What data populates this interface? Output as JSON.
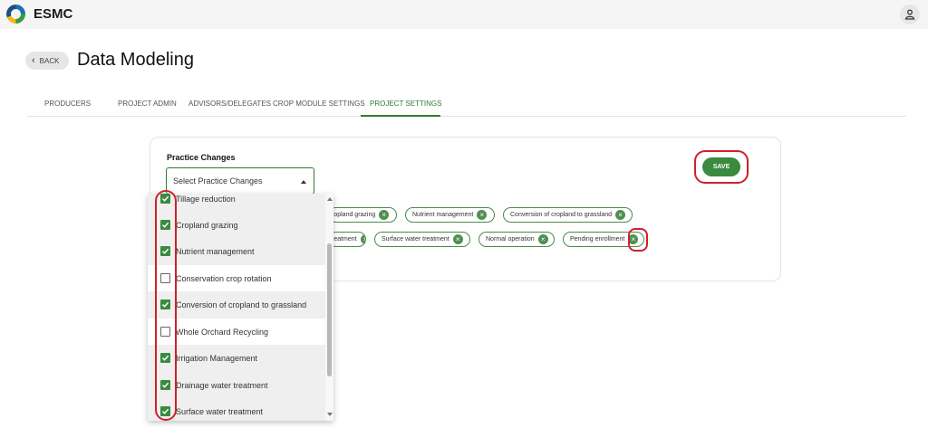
{
  "app": {
    "name": "ESMC"
  },
  "header": {
    "back_label": "BACK",
    "title": "Data Modeling"
  },
  "tabs": [
    {
      "label": "PRODUCERS",
      "active": false
    },
    {
      "label": "PROJECT ADMIN",
      "active": false
    },
    {
      "label": "ADVISORS/DELEGATES",
      "active": false
    },
    {
      "label": "CROP MODULE SETTINGS",
      "active": false
    },
    {
      "label": "PROJECT SETTINGS",
      "active": true
    }
  ],
  "practice_changes": {
    "label": "Practice Changes",
    "placeholder": "Select Practice Changes",
    "save_label": "SAVE",
    "chips_row1": [
      "ropland grazing",
      "Nutrient management",
      "Conversion of cropland to grassland"
    ],
    "chips_row2": [
      "reatment",
      "Surface water treatment",
      "Normal operation",
      "Pending enrollment"
    ]
  },
  "dropdown": {
    "options": [
      {
        "label": "Tillage reduction",
        "checked": true
      },
      {
        "label": "Cropland grazing",
        "checked": true
      },
      {
        "label": "Nutrient management",
        "checked": true
      },
      {
        "label": "Conservation crop rotation",
        "checked": false
      },
      {
        "label": "Conversion of cropland to grassland",
        "checked": true
      },
      {
        "label": "Whole Orchard Recycling",
        "checked": false
      },
      {
        "label": "Irrigation Management",
        "checked": true
      },
      {
        "label": "Drainage water treatment",
        "checked": true
      },
      {
        "label": "Surface water treatment",
        "checked": true
      }
    ]
  },
  "colors": {
    "accent": "#2e7d32",
    "highlight": "#d0202a"
  },
  "icons": {
    "logo": "esmc-logo-icon",
    "user": "user-icon",
    "back": "chevron-left-icon",
    "caret": "caret-up-icon",
    "chip_remove": "close-circle-icon",
    "check": "check-icon"
  }
}
